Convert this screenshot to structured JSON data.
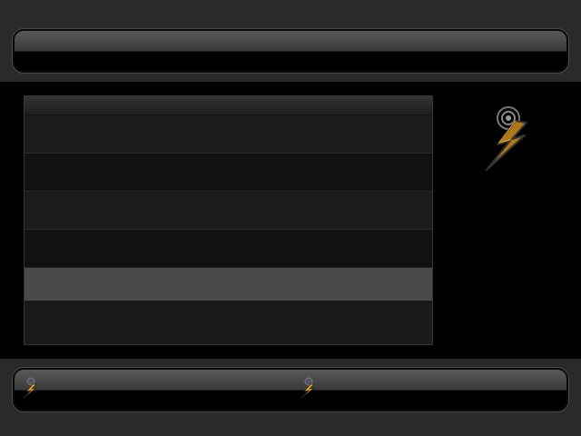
{
  "header": {
    "title": ""
  },
  "list": {
    "rows": [
      {
        "label": ""
      },
      {
        "label": ""
      },
      {
        "label": ""
      },
      {
        "label": ""
      },
      {
        "label": ""
      }
    ]
  },
  "status": {
    "left_text": "",
    "right_text": ""
  },
  "icons": {
    "main": "radio-tower-lightning-icon",
    "status": "radio-tower-lightning-icon"
  },
  "colors": {
    "background": "#000000",
    "band": "#2a2a2a",
    "accent": "#f0a020",
    "selected_row": "#4a4a4a"
  }
}
